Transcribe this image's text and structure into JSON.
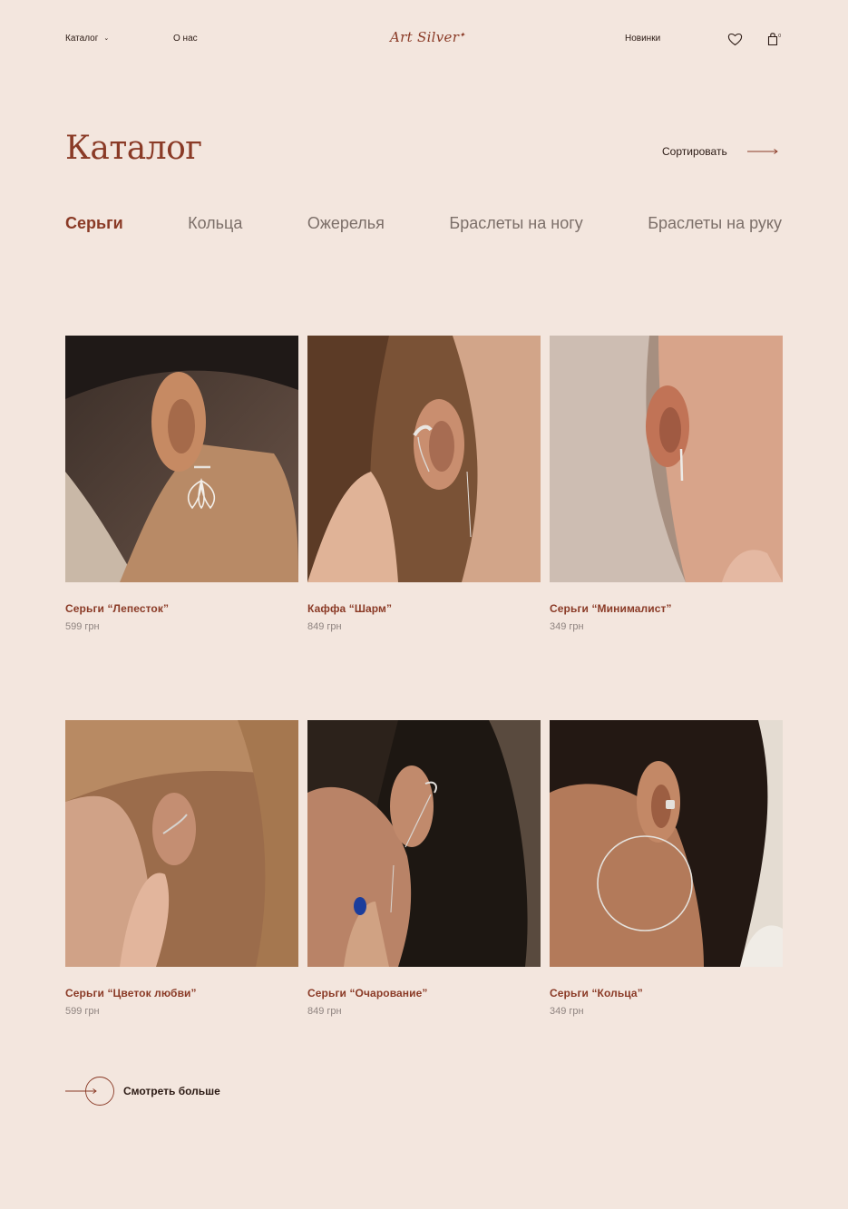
{
  "header": {
    "catalog_label": "Каталог",
    "about_label": "О нас",
    "logo_text": "Art Silver",
    "new_label": "Новинки",
    "cart_count": "0",
    "icons": [
      "chevron-down-icon",
      "heart-icon",
      "shopping-bag-icon"
    ]
  },
  "page": {
    "title": "Каталог",
    "sort_label": "Сортировать"
  },
  "tabs": [
    {
      "label": "Серьги",
      "active": true
    },
    {
      "label": "Кольца",
      "active": false
    },
    {
      "label": "Ожерелья",
      "active": false
    },
    {
      "label": "Браслеты на ногу",
      "active": false
    },
    {
      "label": "Браслеты на руку",
      "active": false
    }
  ],
  "products": [
    {
      "name": "Серьги “Лепесток”",
      "price": "599 грн"
    },
    {
      "name": "Каффа “Шарм”",
      "price": "849 грн"
    },
    {
      "name": "Серьги “Минималист”",
      "price": "349 грн"
    },
    {
      "name": "Серьги “Цветок любви”",
      "price": "599 грн"
    },
    {
      "name": "Серьги “Очарование”",
      "price": "849 грн"
    },
    {
      "name": "Серьги “Кольца”",
      "price": "349 грн"
    }
  ],
  "footer": {
    "more_label": "Смотреть больше"
  },
  "colors": {
    "background": "#f3e6de",
    "accent": "#8a3a26",
    "text": "#2b1a14",
    "muted": "#7c6f69"
  }
}
